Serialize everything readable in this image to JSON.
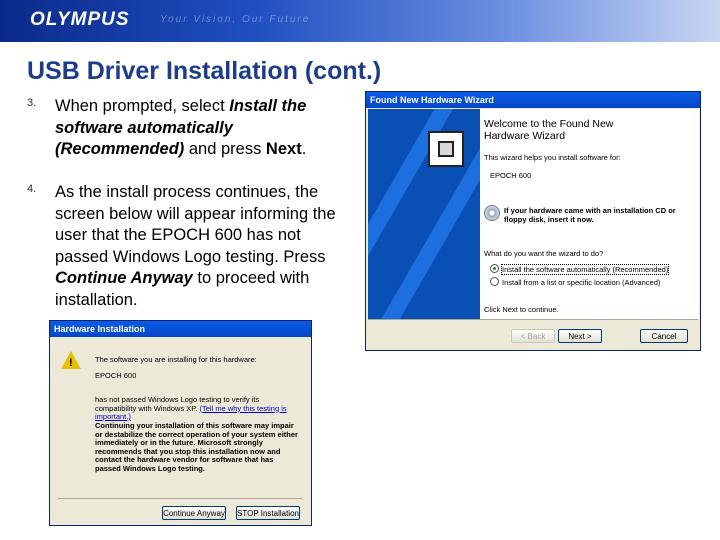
{
  "header": {
    "brand": "OLYMPUS",
    "tagline": "Your Vision, Our Future"
  },
  "title": "USB Driver Installation (cont.)",
  "steps": [
    {
      "number": "3.",
      "segments": [
        {
          "text": "When prompted, select ",
          "style": "normal"
        },
        {
          "text": "Install the software automatically (Recommended)",
          "style": "bi"
        },
        {
          "text": " and press ",
          "style": "normal"
        },
        {
          "text": "Next",
          "style": "b"
        },
        {
          "text": ".",
          "style": "normal"
        }
      ]
    },
    {
      "number": "4.",
      "segments": [
        {
          "text": "As the install process continues, the screen below will appear informing the user that the EPOCH 600 has not passed Windows Logo testing.  Press ",
          "style": "normal"
        },
        {
          "text": "Continue Anyway",
          "style": "bi"
        },
        {
          "text": " to proceed with installation.",
          "style": "normal"
        }
      ]
    }
  ],
  "wizard": {
    "title": "Found New Hardware Wizard",
    "heading": "Welcome to the Found New Hardware Wizard",
    "intro": "This wizard helps you install software for:",
    "device": "EPOCH 600",
    "cd_prompt": "If your hardware came with an installation CD or floppy disk, insert it now.",
    "question": "What do you want the wizard to do?",
    "options": [
      {
        "label": "Install the software automatically (Recommended)",
        "selected": true
      },
      {
        "label": "Install from a list or specific location (Advanced)",
        "selected": false
      }
    ],
    "footer_text": "Click Next to continue.",
    "buttons": {
      "back": "< Back",
      "next": "Next >",
      "cancel": "Cancel"
    }
  },
  "hardware_dialog": {
    "title": "Hardware Installation",
    "line1": "The software you are installing for this hardware:",
    "device": "EPOCH 600",
    "logo_text": "has not passed Windows Logo testing to verify its compatibility with Windows XP.",
    "logo_link": "(Tell me why this testing is important.)",
    "warning": "Continuing your installation of this software may impair or destabilize the correct operation of your system either immediately or in the future. Microsoft strongly recommends that you stop this installation now and contact the hardware vendor for software that has passed Windows Logo testing.",
    "buttons": {
      "continue": "Continue Anyway",
      "stop": "STOP Installation"
    }
  },
  "colors": {
    "title": "#1d3c8c",
    "banner_dark": "#0a2a8a",
    "xp_titlebar": "#0646c8"
  }
}
